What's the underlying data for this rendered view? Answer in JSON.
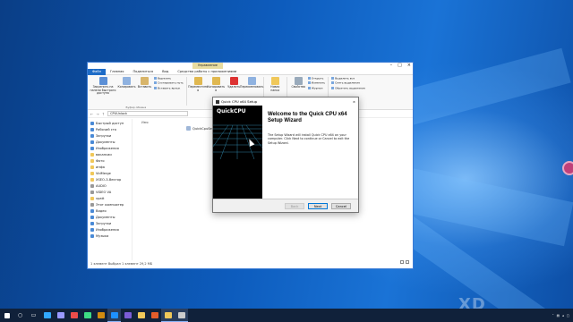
{
  "explorer": {
    "context_tab": "Управление",
    "tabs": [
      "Файл",
      "Главная",
      "Поделиться",
      "Вид",
      "Средства работы с приложениями"
    ],
    "ribbon": {
      "clipboard": {
        "pin": "Закрепить на панели быстрого доступа",
        "copy": "Копировать",
        "paste": "Вставить",
        "cut": "Вырезать",
        "copy_path": "Скопировать путь",
        "paste_shortcut": "Вставить ярлык",
        "group": "Буфер обмена"
      },
      "organize": {
        "move": "Переместить в",
        "copy_to": "Копировать в",
        "delete": "Удалить",
        "rename": "Переименовать",
        "group": "Упорядочить"
      },
      "new": {
        "folder": "Новая папка",
        "group": "Создать"
      },
      "open": {
        "properties": "Свойства",
        "open": "Открыть",
        "edit": "Изменить",
        "journal": "Журнал",
        "group": "Открыть"
      },
      "select": {
        "all": "Выделить все",
        "none": "Снять выделение",
        "invert": "Обратить выделение",
        "group": "Выделить"
      }
    },
    "address": "CPUUnlock",
    "column_header": "Имя",
    "nav": [
      "Быстрый доступ",
      "Рабочий сто",
      "Загрузки",
      "Документы",
      "Изображения",
      "вакансии",
      "Фото",
      "инфа",
      "VidMerge",
      "XSEO-3-Вектор",
      "AUDIO",
      "VIDEO VA",
      "vpatt",
      "Этот компьютер",
      "Видео",
      "Документы",
      "Загрузки",
      "Изображения",
      "Музыка"
    ],
    "file": "QuickCpuSetup-3.3.2.0-x64.msi",
    "status": "1 элемент   Выбран 1 элемент 29,2 МБ"
  },
  "setup": {
    "title": "Quick CPU x64 Setup",
    "logo": "QuickCPU",
    "heading": "Welcome to the Quick CPU x64 Setup Wizard",
    "body": "The Setup Wizard will install Quick CPU x64 on your computer. Click Next to continue or Cancel to exit the Setup Wizard.",
    "back": "Back",
    "next": "Next",
    "cancel": "Cancel"
  },
  "watermark": "XD"
}
